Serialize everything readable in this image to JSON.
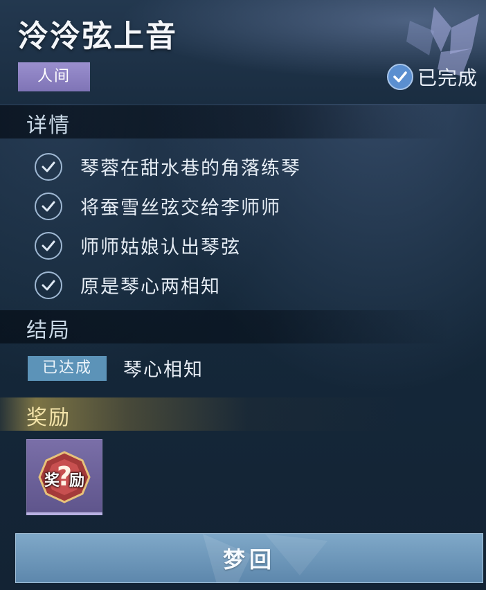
{
  "header": {
    "title": "泠泠弦上音",
    "realm_tag": "人间",
    "status": "已完成"
  },
  "details": {
    "heading": "详情",
    "steps": [
      {
        "text": "琴蓉在甜水巷的角落练琴",
        "done": true
      },
      {
        "text": "将蚕雪丝弦交给李师师",
        "done": true
      },
      {
        "text": "师师姑娘认出琴弦",
        "done": true
      },
      {
        "text": "原是琴心两相知",
        "done": true
      }
    ]
  },
  "ending": {
    "heading": "结局",
    "badge": "已达成",
    "name": "琴心相知"
  },
  "reward": {
    "heading": "奖励",
    "item_label": "奖励"
  },
  "footer": {
    "button_label": "梦回"
  },
  "colors": {
    "realm_tag": "#8d83c4",
    "status_check": "#5b8fd0",
    "ending_badge": "#5c93b8",
    "reward_card": "#6d639c",
    "button": "#6f98bb"
  }
}
